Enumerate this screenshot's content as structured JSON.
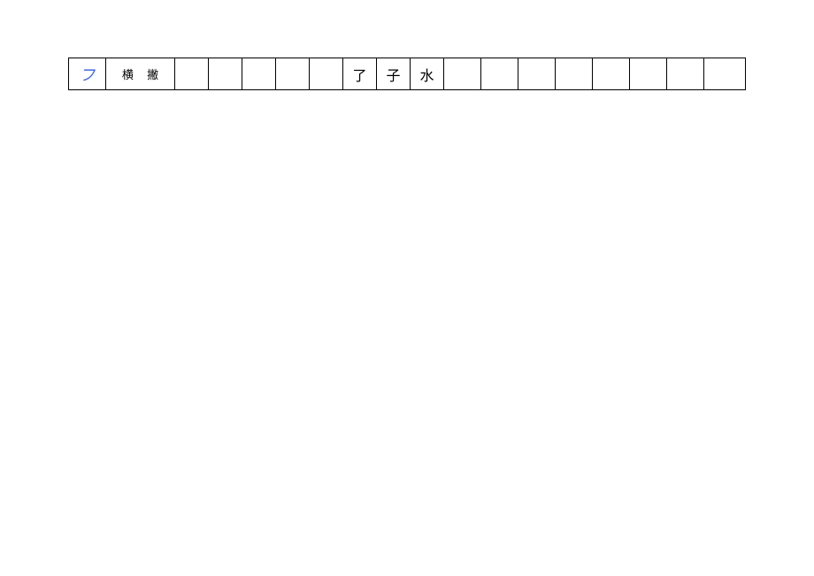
{
  "table": {
    "stroke_symbol": "フ",
    "stroke_name": "横 撇",
    "example_chars": [
      "了",
      "子",
      "水"
    ]
  }
}
